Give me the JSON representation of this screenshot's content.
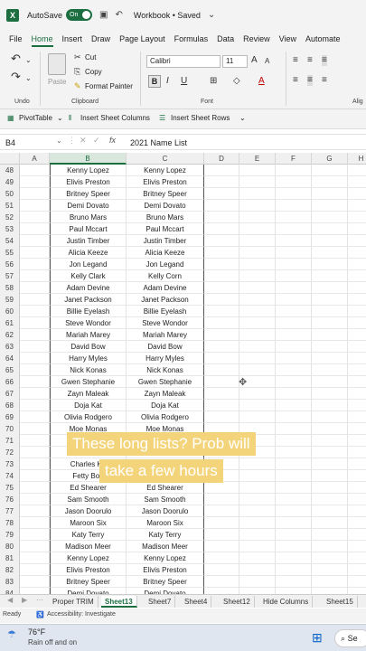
{
  "titlebar": {
    "autosave_label": "AutoSave",
    "toggle_label": "On",
    "workbook_title": "Workbook • Saved"
  },
  "menu": [
    "File",
    "Home",
    "Insert",
    "Draw",
    "Page Layout",
    "Formulas",
    "Data",
    "Review",
    "View",
    "Automate"
  ],
  "ribbon": {
    "cut": "Cut",
    "copy": "Copy",
    "format_painter": "Format Painter",
    "paste": "Paste",
    "font_name": "Calibri",
    "font_size": "11",
    "undo_label": "Undo",
    "clipboard_label": "Clipboard",
    "font_label": "Font",
    "alignment_label": "Alig"
  },
  "quickbar": {
    "pivot": "PivotTable",
    "insert_cols": "Insert Sheet Columns",
    "insert_rows": "Insert Sheet Rows"
  },
  "formula_bar": {
    "name_box": "B4",
    "formula": "2021 Name List"
  },
  "columns": [
    "A",
    "B",
    "C",
    "D",
    "E",
    "F",
    "G",
    "H"
  ],
  "rows": [
    {
      "n": "48",
      "b": "Kenny Lopez",
      "c": "Kenny Lopez"
    },
    {
      "n": "49",
      "b": "Elivis Preston",
      "c": "Elivis Preston"
    },
    {
      "n": "50",
      "b": "Britney Speer",
      "c": "Britney Speer"
    },
    {
      "n": "51",
      "b": "Demi Dovato",
      "c": "Demi Dovato"
    },
    {
      "n": "52",
      "b": "Bruno Mars",
      "c": "Bruno Mars"
    },
    {
      "n": "53",
      "b": "Paul Mccart",
      "c": "Paul Mccart"
    },
    {
      "n": "54",
      "b": "Justin Timber",
      "c": "Justin Timber"
    },
    {
      "n": "55",
      "b": "Alicia Keeze",
      "c": "Alicia Keeze"
    },
    {
      "n": "56",
      "b": "Jon Legand",
      "c": "Jon Legand"
    },
    {
      "n": "57",
      "b": "Kelly Clark",
      "c": "Kelly Corn"
    },
    {
      "n": "58",
      "b": "Adam Devine",
      "c": "Adam Devine"
    },
    {
      "n": "59",
      "b": "Janet Packson",
      "c": "Janet Packson"
    },
    {
      "n": "60",
      "b": "Billie Eyelash",
      "c": "Billie Eyelash"
    },
    {
      "n": "61",
      "b": "Steve Wondor",
      "c": "Steve Wondor"
    },
    {
      "n": "62",
      "b": "Mariah Marey",
      "c": "Mariah Marey"
    },
    {
      "n": "63",
      "b": "David Bow",
      "c": "David Bow"
    },
    {
      "n": "64",
      "b": "Harry Myles",
      "c": "Harry Myles"
    },
    {
      "n": "65",
      "b": "Nick Konas",
      "c": "Nick Konas"
    },
    {
      "n": "66",
      "b": "Gwen Stephanie",
      "c": "Gwen Stephanie"
    },
    {
      "n": "67",
      "b": "Zayn Maleak",
      "c": "Zayn Maleak"
    },
    {
      "n": "68",
      "b": "Doja Kat",
      "c": "Doja Kat"
    },
    {
      "n": "69",
      "b": "Olivia Rodgero",
      "c": "Olivia Rodgero"
    },
    {
      "n": "70",
      "b": "Moe Monas",
      "c": "Moe Monas"
    },
    {
      "n": "71",
      "b": "",
      "c": ""
    },
    {
      "n": "72",
      "b": "",
      "c": ""
    },
    {
      "n": "73",
      "b": "Charles Ka",
      "c": ""
    },
    {
      "n": "74",
      "b": "Fetty Bop",
      "c": ""
    },
    {
      "n": "75",
      "b": "Ed Shearer",
      "c": "Ed Shearer"
    },
    {
      "n": "76",
      "b": "Sam Smooth",
      "c": "Sam Smooth"
    },
    {
      "n": "77",
      "b": "Jason Doorulo",
      "c": "Jason Doorulo"
    },
    {
      "n": "78",
      "b": "Maroon Six",
      "c": "Maroon Six"
    },
    {
      "n": "79",
      "b": "Katy Terry",
      "c": "Katy Terry"
    },
    {
      "n": "80",
      "b": "Madison Meer",
      "c": "Madison Meer"
    },
    {
      "n": "81",
      "b": "Kenny Lopez",
      "c": "Kenny Lopez"
    },
    {
      "n": "82",
      "b": "Elivis Preston",
      "c": "Elivis Preston"
    },
    {
      "n": "83",
      "b": "Britney Speer",
      "c": "Britney Speer"
    },
    {
      "n": "84",
      "b": "Demi Dovato",
      "c": "Demi Dovato"
    }
  ],
  "caption": {
    "line1": "These long lists? Prob will",
    "line2": "take a few hours"
  },
  "sheets": [
    {
      "name": "Proper TRIM",
      "active": false
    },
    {
      "name": "Sheet13",
      "active": true
    },
    {
      "name": "Sheet7",
      "active": false
    },
    {
      "name": "Sheet4",
      "active": false
    },
    {
      "name": "Sheet12",
      "active": false
    },
    {
      "name": "Hide Columns",
      "active": false
    },
    {
      "name": "Sheet15",
      "active": false
    }
  ],
  "status": {
    "ready": "Ready",
    "accessibility": "Accessibility: Investigate"
  },
  "taskbar": {
    "temp": "76°F",
    "weather": "Rain off and on",
    "search": "Se"
  },
  "colors": {
    "accent": "#1d6f42",
    "caption_bg": "#f4d47a"
  }
}
